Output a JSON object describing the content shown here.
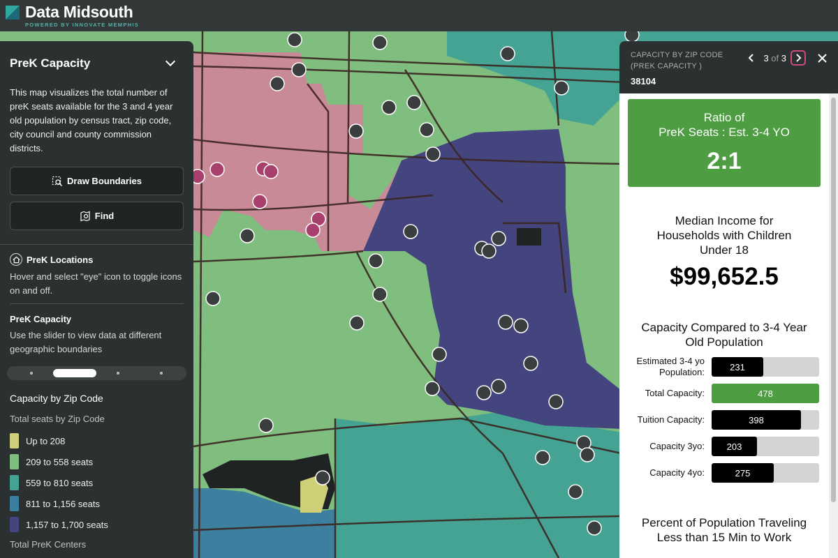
{
  "app": {
    "name": "Data Midsouth",
    "tagline": "POWERED BY INNOVATE MEMPHIS"
  },
  "left_panel": {
    "title": "PreK Capacity",
    "description": "This map visualizes the total number of preK seats available for the 3 and 4 year old population by census tract, zip code, city council and county commission districts.",
    "draw_boundaries_label": "Draw Boundaries",
    "find_label": "Find",
    "locations_title": "PreK Locations",
    "locations_hint": "Hover and select \"eye\" icon to toggle icons on and off.",
    "capacity_title": "PreK Capacity",
    "capacity_hint": "Use the slider to view data at different geographic boundaries",
    "slider_value": 2,
    "layer_title": "Capacity by Zip Code",
    "legend_title": "Total seats by Zip Code",
    "legend": [
      {
        "label": "Up to 208",
        "color": "#cfcf78"
      },
      {
        "label": "209 to 558 seats",
        "color": "#7fbe7f"
      },
      {
        "label": "559 to 810 seats",
        "color": "#44a392"
      },
      {
        "label": "811 to 1,156 seats",
        "color": "#3c7f9e"
      },
      {
        "label": "1,157 to 1,700 seats",
        "color": "#44457e"
      }
    ],
    "next_section": "Total PreK Centers"
  },
  "right_panel": {
    "caption_line1": "CAPACITY BY ZIP CODE",
    "caption_line2": "(PREK CAPACITY )",
    "zip": "38104",
    "page_current": "3",
    "page_of": "of",
    "page_total": "3",
    "ratio": {
      "line1": "Ratio of",
      "line2": "PreK Seats : Est. 3-4 YO",
      "value": "2:1",
      "color": "#4e9d42"
    },
    "income": {
      "title": "Median Income for Households with Children Under 18",
      "value": "$99,652.5"
    },
    "capacity": {
      "title": "Capacity Compared to 3-4 Year Old Population",
      "max": 478,
      "rows": [
        {
          "label": "Estimated 3-4 yo Population:",
          "value": 231,
          "display": "231",
          "highlight": false
        },
        {
          "label": "Total Capacity:",
          "value": 478,
          "display": "478",
          "highlight": true
        },
        {
          "label": "Tuition Capacity:",
          "value": 398,
          "display": "398",
          "highlight": false
        },
        {
          "label": "Capacity 3yo:",
          "value": 203,
          "display": "203",
          "highlight": false
        },
        {
          "label": "Capacity 4yo:",
          "value": 275,
          "display": "275",
          "highlight": false
        }
      ]
    },
    "travel": {
      "title": "Percent of Population Traveling Less than 15 Min to Work"
    }
  },
  "colors": {
    "accent_green": "#4e9d42",
    "highlight_pink": "#d04a7c",
    "panel_dark": "#2b3131"
  }
}
